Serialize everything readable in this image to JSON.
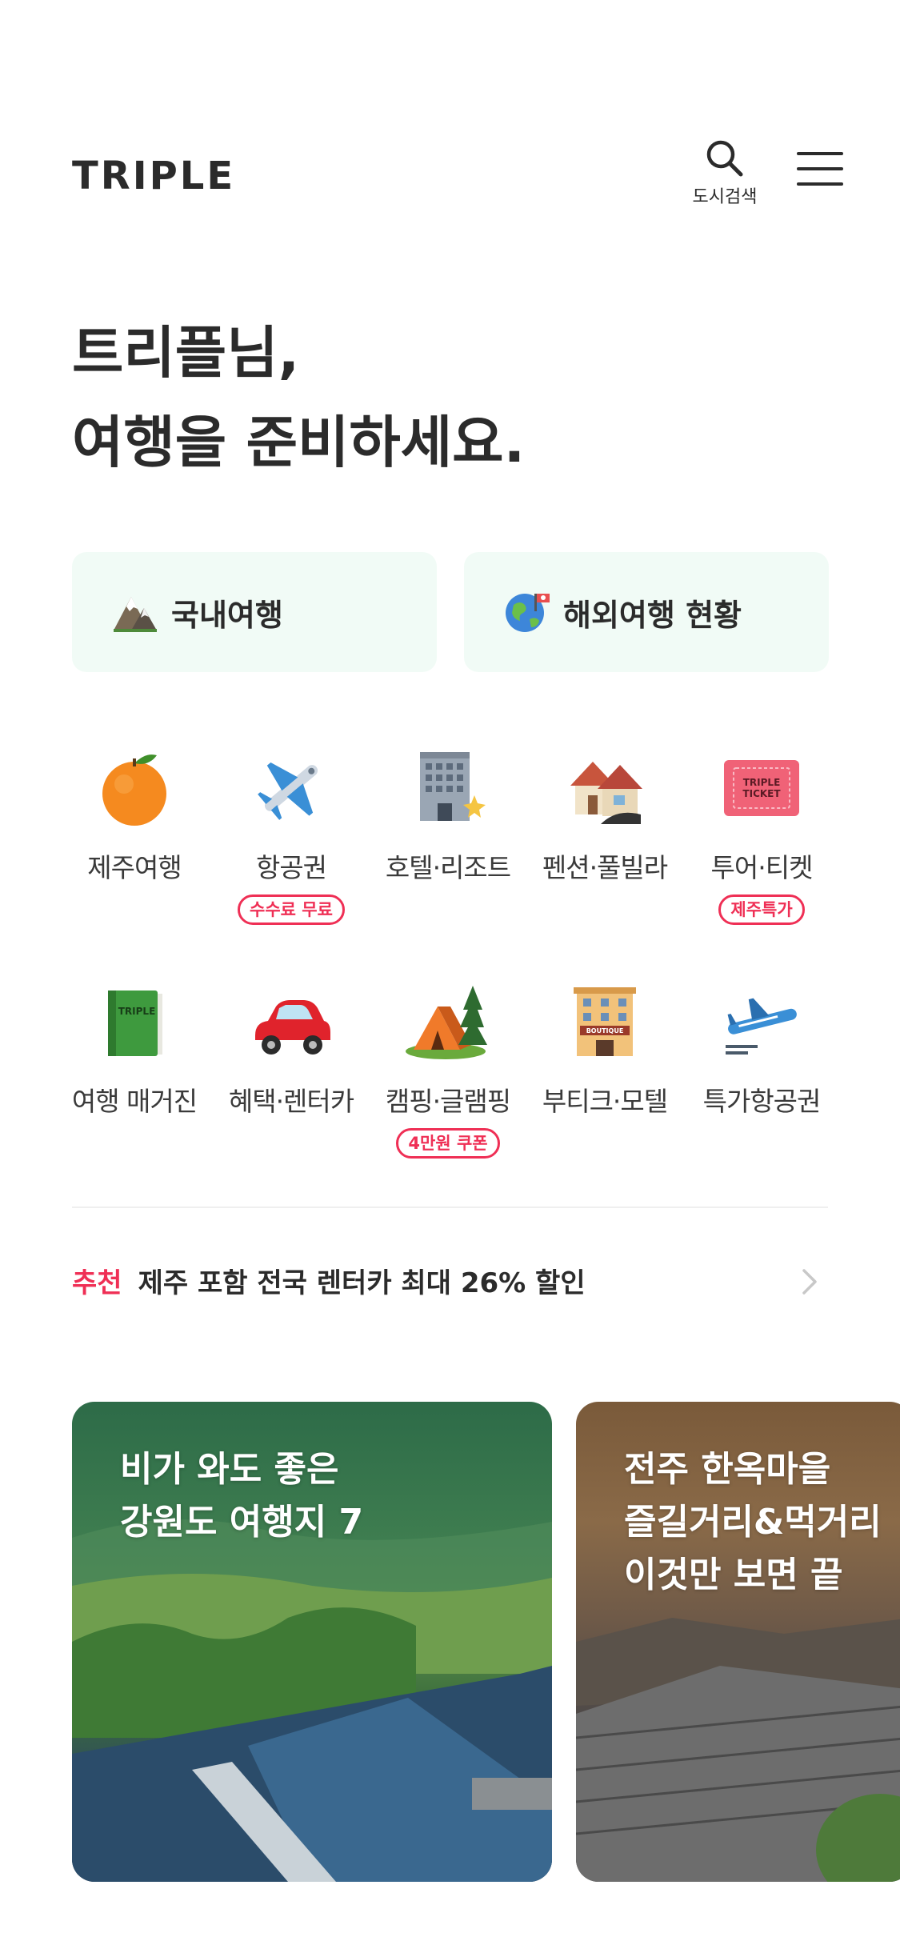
{
  "header": {
    "logo": "TRIPLE",
    "search_label": "도시검색"
  },
  "greeting": {
    "line1": "트리플님,",
    "line2": "여행을 준비하세요."
  },
  "quick_links": [
    {
      "label": "국내여행",
      "icon": "mountain-icon"
    },
    {
      "label": "해외여행 현황",
      "icon": "globe-icon"
    }
  ],
  "categories": [
    {
      "label": "제주여행",
      "icon": "tangerine-icon",
      "badge": ""
    },
    {
      "label": "항공권",
      "icon": "airplane-icon",
      "badge": "수수료 무료"
    },
    {
      "label": "호텔·리조트",
      "icon": "hotel-icon",
      "badge": ""
    },
    {
      "label": "펜션·풀빌라",
      "icon": "houses-icon",
      "badge": ""
    },
    {
      "label": "투어·티켓",
      "icon": "ticket-icon",
      "badge": "제주특가"
    },
    {
      "label": "여행 매거진",
      "icon": "book-icon",
      "badge": ""
    },
    {
      "label": "혜택·렌터카",
      "icon": "car-icon",
      "badge": ""
    },
    {
      "label": "캠핑·글램핑",
      "icon": "tent-icon",
      "badge": "4만원 쿠폰"
    },
    {
      "label": "부티크·모텔",
      "icon": "boutique-icon",
      "badge": ""
    },
    {
      "label": "특가항공권",
      "icon": "departure-plane-icon",
      "badge": ""
    }
  ],
  "ticket_icon_text": "TRIPLE TICKET",
  "book_icon_text": "TRIPLE",
  "boutique_icon_text": "BOUTIQUE",
  "promo": {
    "tag": "추천",
    "text": "제주 포함 전국 렌터카 최대 26% 할인"
  },
  "cards": [
    {
      "lines": [
        "비가 와도 좋은",
        "강원도 여행지 7"
      ]
    },
    {
      "lines": [
        "전주 한옥마을",
        "즐길거리&먹거리",
        "이것만 보면 끝"
      ]
    }
  ],
  "colors": {
    "accent_red": "#ef2f55",
    "quick_bg": "#f1fbf6",
    "text": "#2b2b2b"
  }
}
